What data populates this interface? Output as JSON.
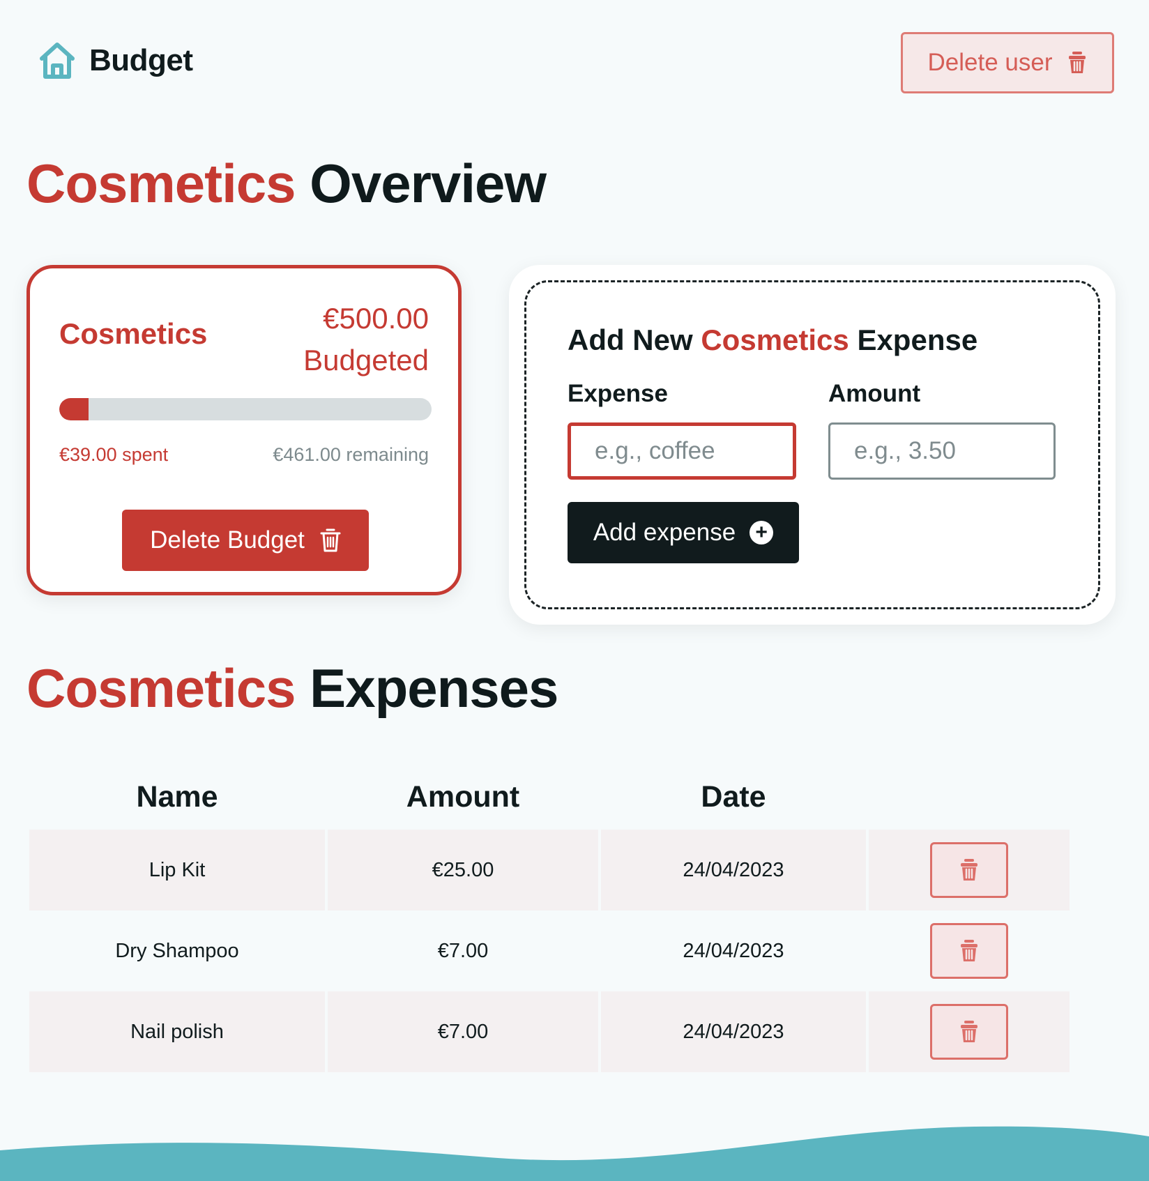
{
  "header": {
    "logo_text": "Budget",
    "delete_user_label": "Delete user"
  },
  "overview": {
    "title_accent": "Cosmetics",
    "title_rest": "Overview"
  },
  "budget_card": {
    "name": "Cosmetics",
    "amount": "€500.00",
    "budgeted_label": "Budgeted",
    "spent": "€39.00 spent",
    "remaining": "€461.00 remaining",
    "progress_fraction": 0.078,
    "delete_label": "Delete Budget"
  },
  "add_expense": {
    "title_prefix": "Add New",
    "title_accent": "Cosmetics",
    "title_suffix": "Expense",
    "expense_label": "Expense",
    "expense_placeholder": "e.g., coffee",
    "amount_label": "Amount",
    "amount_placeholder": "e.g., 3.50",
    "button_label": "Add expense"
  },
  "expenses": {
    "title_accent": "Cosmetics",
    "title_rest": "Expenses",
    "columns": [
      "Name",
      "Amount",
      "Date",
      ""
    ],
    "rows": [
      {
        "name": "Lip Kit",
        "amount": "€25.00",
        "date": "24/04/2023"
      },
      {
        "name": "Dry Shampoo",
        "amount": "€7.00",
        "date": "24/04/2023"
      },
      {
        "name": "Nail polish",
        "amount": "€7.00",
        "date": "24/04/2023"
      }
    ]
  },
  "colors": {
    "accent": "#c53a32",
    "dark": "#111b1d",
    "teal": "#5bb5c0",
    "background": "#f6fafb"
  },
  "icons": {
    "logo": "home-icon",
    "delete": "trash-icon",
    "add": "plus-circle-icon"
  }
}
